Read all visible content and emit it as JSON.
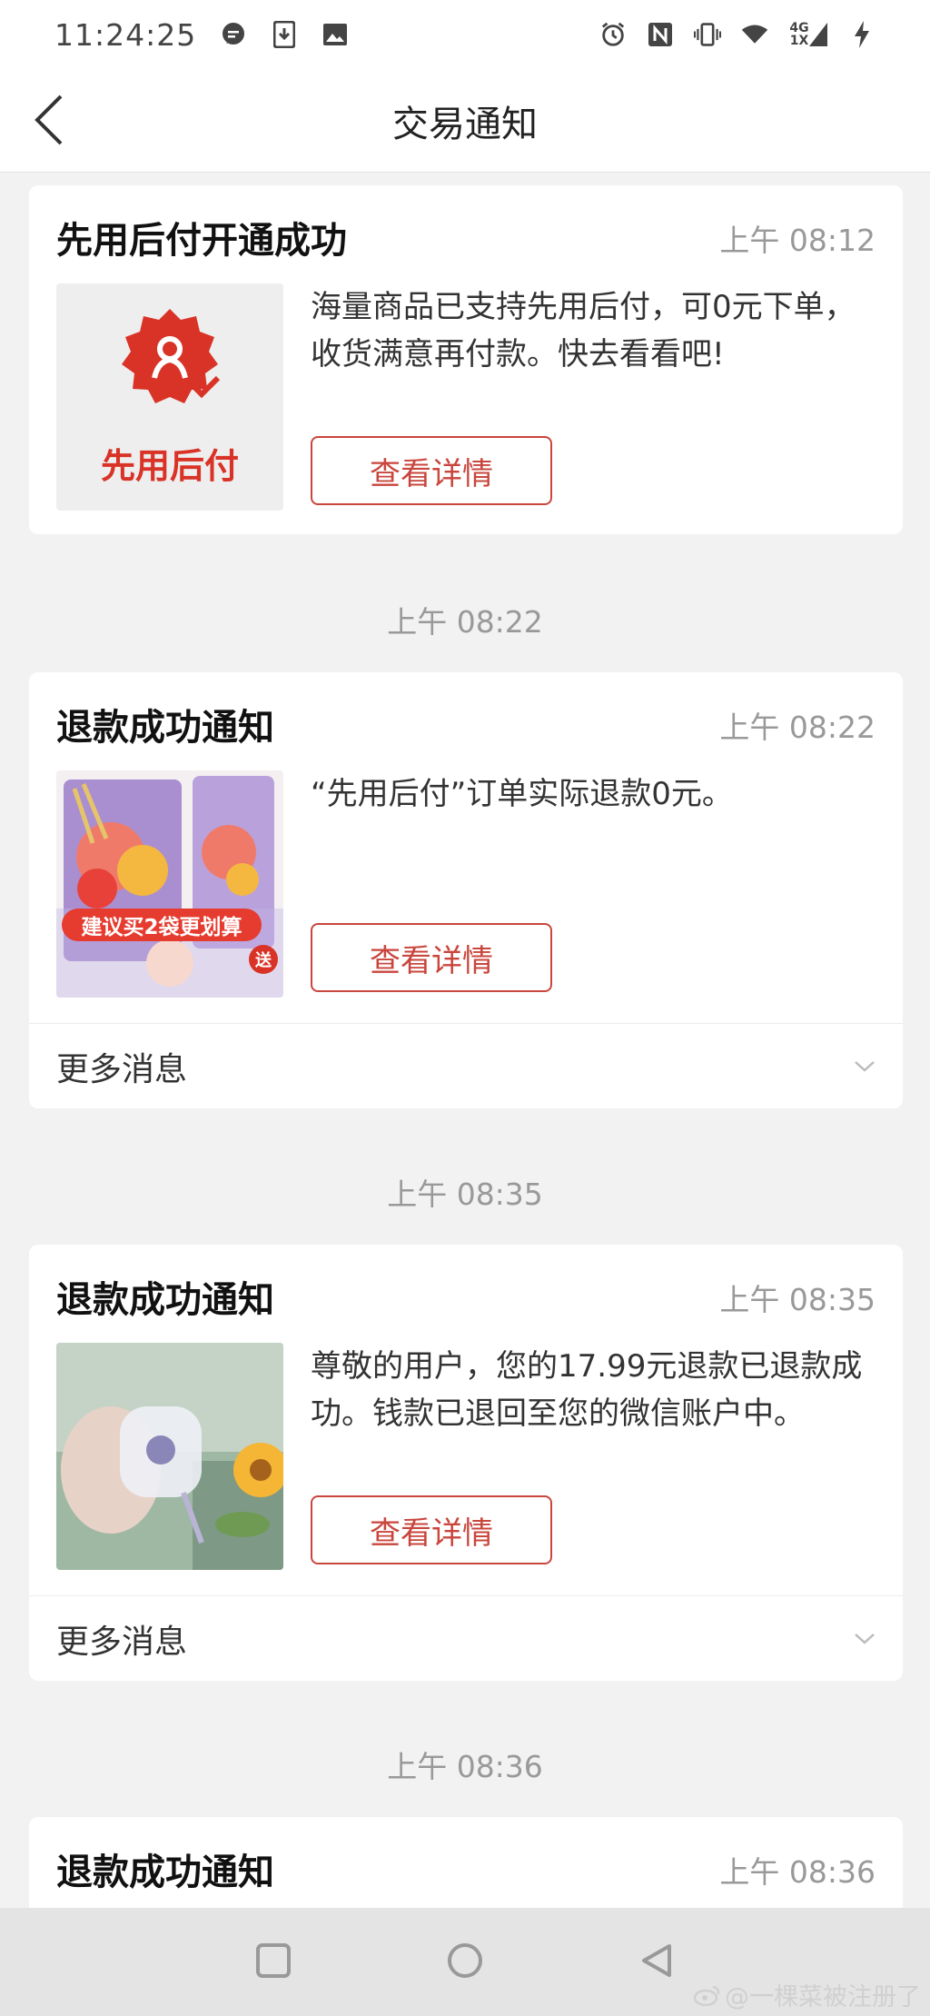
{
  "status_bar": {
    "time": "11:24:25",
    "left_icons": [
      "chat-bubble-icon",
      "download-icon",
      "image-icon"
    ],
    "right_icons": [
      "alarm-icon",
      "nfc-icon",
      "vibrate-icon",
      "wifi-icon",
      "signal-icon",
      "charging-icon"
    ],
    "network_top": "4G",
    "network_bottom": "1X"
  },
  "nav": {
    "title": "交易通知"
  },
  "cards": [
    {
      "title": "先用后付开通成功",
      "time": "上午 08:12",
      "text": "海量商品已支持先用后付，可0元下单，收货满意再付款。快去看看吧!",
      "button": "查看详情",
      "thumb_label": "先用后付"
    },
    {
      "title": "退款成功通知",
      "time": "上午 08:22",
      "text": "“先用后付”订单实际退款0元。",
      "button": "查看详情",
      "thumb_banner": "建议买2袋更划算",
      "thumb_badge": "送",
      "more": "更多消息"
    },
    {
      "title": "退款成功通知",
      "time": "上午 08:35",
      "text": "尊敬的用户，您的17.99元退款已退款成功。钱款已退回至您的微信账户中。",
      "button": "查看详情",
      "more": "更多消息"
    },
    {
      "title": "退款成功通知",
      "time": "上午 08:36"
    }
  ],
  "dividers": [
    "上午 08:22",
    "上午 08:35",
    "上午 08:36"
  ],
  "bottom_nav": [
    "square-recents-icon",
    "circle-home-icon",
    "triangle-back-icon"
  ],
  "watermark": "@一棵菜被注册了",
  "colors": {
    "accent": "#c9463d",
    "background": "#f2f2f2",
    "card": "#ffffff"
  }
}
